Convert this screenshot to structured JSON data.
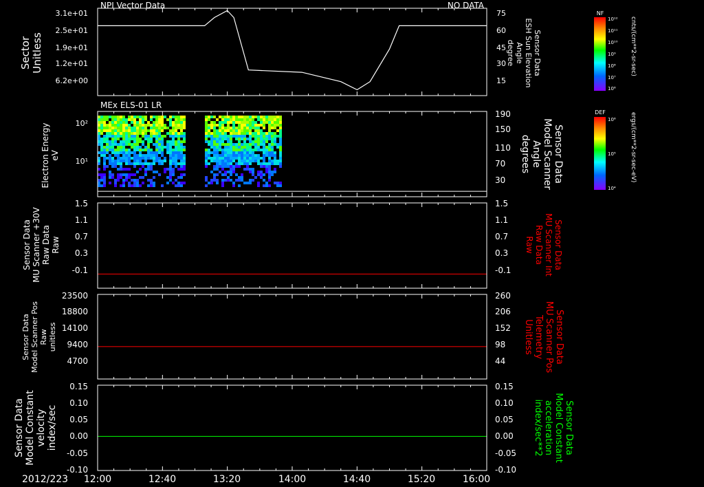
{
  "date_label": "2012/223",
  "time_ticks": [
    "12:00",
    "12:40",
    "13:20",
    "14:00",
    "14:40",
    "15:20",
    "16:00"
  ],
  "chart_data": [
    {
      "type": "line",
      "title": "NPI Vector Data",
      "status": "NO DATA",
      "ylabel_lines": [
        "Sector",
        "Unitless"
      ],
      "yticks": [
        "3.1e+01",
        "2.5e+01",
        "1.9e+01",
        "1.2e+01",
        "6.2e+00"
      ],
      "right_ticks": [
        "75",
        "60",
        "45",
        "30",
        "15"
      ],
      "right_label_lines": [
        "Sensor Data",
        "ESH Sun Elevation",
        "Angle",
        "degree"
      ],
      "right_ylim": [
        0,
        75
      ],
      "x_hours": [
        12.0,
        13.1,
        13.2,
        13.333,
        13.4,
        13.55,
        14.1,
        14.5,
        14.667,
        14.8,
        15.0,
        15.1,
        16.0
      ],
      "series": [
        {
          "values": [
            60,
            60,
            67,
            73,
            67,
            22,
            20,
            12,
            5,
            12,
            40,
            60,
            60
          ],
          "color": "#ffffff"
        }
      ]
    },
    {
      "type": "heatmap",
      "title": "MEx ELS-01 LR",
      "ylabel_lines": [
        "Electron Energy",
        "eV"
      ],
      "yticks": [
        "10²",
        "10¹"
      ],
      "right_ticks": [
        "190",
        "150",
        "110",
        "70",
        "30"
      ],
      "right_label_lines": [
        "Sensor Data",
        "Model Scanner",
        "Angle",
        "degrees"
      ],
      "right_ylim": [
        0,
        190
      ],
      "x_range_hours": [
        12.0,
        13.87
      ],
      "colorbar": {
        "label": "DEF",
        "units": "ergs/(cm**2-sr-sec-eV)",
        "ticks": [
          "10⁶",
          "10⁵",
          "10⁴"
        ]
      },
      "overlay_line": {
        "value": 12,
        "color": "#ffffff"
      }
    },
    {
      "type": "line",
      "ylabel_lines": [
        "Sensor Data",
        "MU Scanner +30V",
        "Raw Data",
        "Raw"
      ],
      "yticks": [
        "1.5",
        "1.1",
        "0.7",
        "0.3",
        "-0.1"
      ],
      "right_ticks": [
        "1.5",
        "1.1",
        "0.7",
        "0.3",
        "-0.1"
      ],
      "right_label_lines": [
        "Sensor Data",
        "MU Scanner Int",
        "Raw Data",
        "Raw"
      ],
      "right_label_color": "#ff0000",
      "ylim": [
        -0.3,
        1.5
      ],
      "series": [
        {
          "value": 0.0,
          "color": "#ff0000"
        }
      ]
    },
    {
      "type": "line",
      "ylabel_lines": [
        "Sensor Data",
        "Model Scanner Pos",
        "Raw",
        "unitless"
      ],
      "yticks": [
        "23500",
        "18800",
        "14100",
        "9400",
        "4700"
      ],
      "right_ticks": [
        "260",
        "206",
        "152",
        "98",
        "44"
      ],
      "right_label_lines": [
        "Sensor Data",
        "MU Scanner Pos",
        "Telemetry",
        "Unitless"
      ],
      "right_label_color": "#ff0000",
      "ylim": [
        0,
        23500
      ],
      "series": [
        {
          "value": 9000,
          "color": "#ff0000"
        }
      ]
    },
    {
      "type": "line",
      "ylabel_lines": [
        "Sensor Data",
        "Model Constant",
        "velocity",
        "index/sec"
      ],
      "yticks": [
        "0.15",
        "0.10",
        "0.05",
        "0.00",
        "-0.05",
        "-0.10"
      ],
      "right_ticks": [
        "0.15",
        "0.10",
        "0.05",
        "0.00",
        "-0.05",
        "-0.10"
      ],
      "right_label_lines": [
        "Sensor Data",
        "Model Constant",
        "acceleration",
        "index/sec**2"
      ],
      "right_label_color": "#00ff00",
      "ylim": [
        -0.1,
        0.15
      ],
      "series": [
        {
          "value": 0.0,
          "color": "#00ff00"
        }
      ]
    }
  ],
  "colorbar_nf": {
    "label": "NF",
    "units": "cnts/(cm**2-sr-sec)",
    "ticks": [
      "10¹²",
      "10¹¹",
      "10¹⁰",
      "10⁹",
      "10⁸",
      "10⁷",
      "10⁶"
    ]
  }
}
